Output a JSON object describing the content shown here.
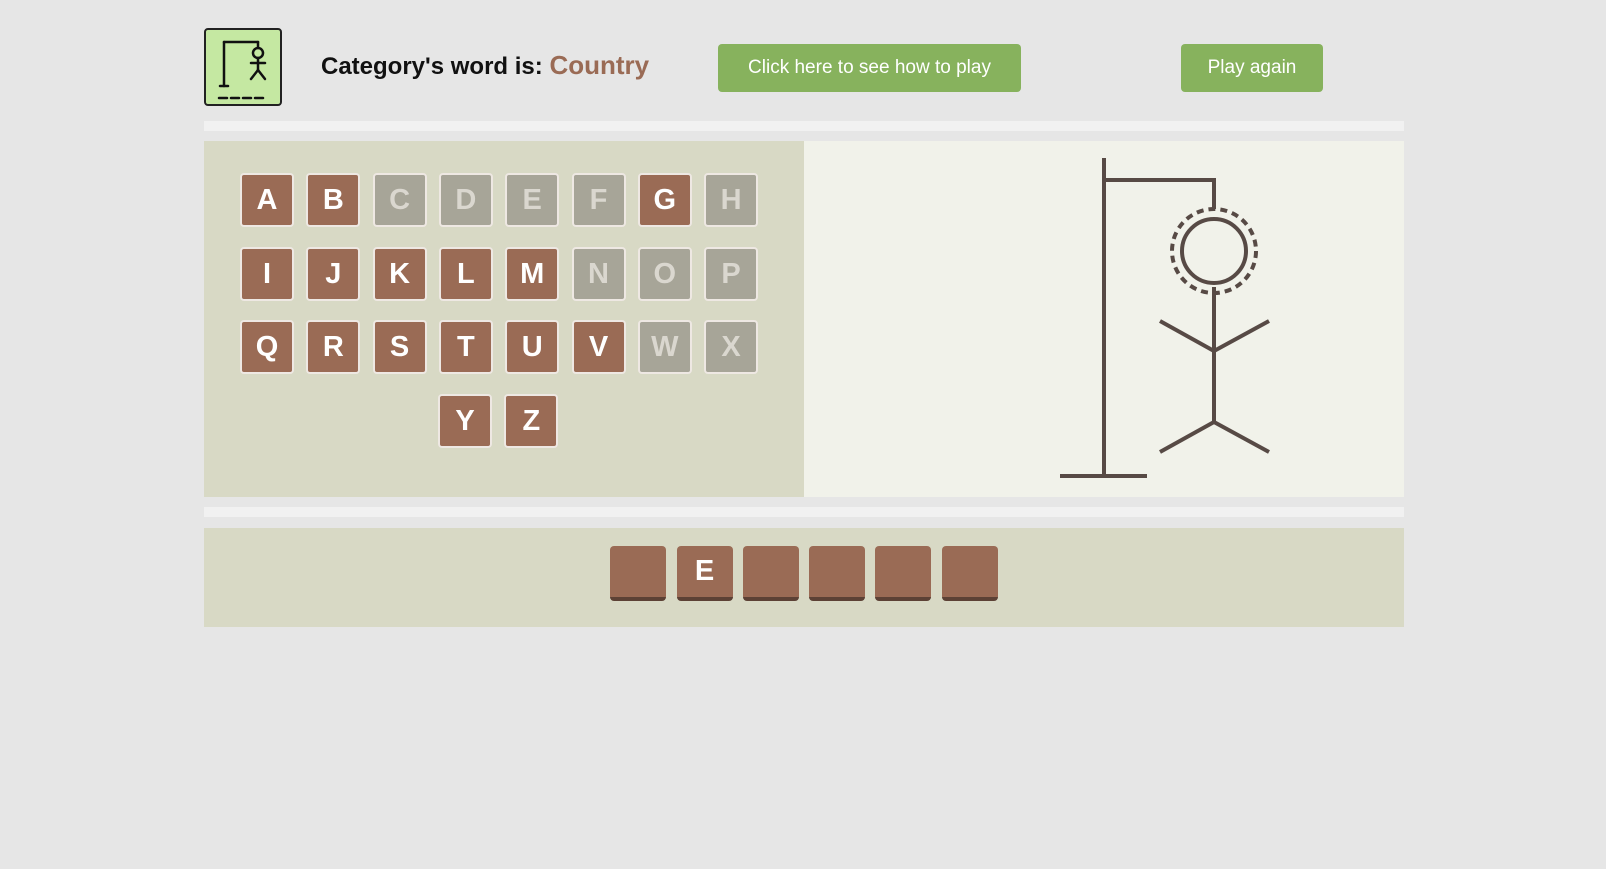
{
  "header": {
    "category_label": "Category's word is:",
    "category_value": "Country",
    "help_button": "Click here to see how to play",
    "play_again_button": "Play again"
  },
  "keyboard": {
    "rows": [
      [
        {
          "letter": "A",
          "state": "active"
        },
        {
          "letter": "B",
          "state": "active"
        },
        {
          "letter": "C",
          "state": "used"
        },
        {
          "letter": "D",
          "state": "used"
        },
        {
          "letter": "E",
          "state": "used"
        },
        {
          "letter": "F",
          "state": "used"
        },
        {
          "letter": "G",
          "state": "active"
        },
        {
          "letter": "H",
          "state": "used"
        }
      ],
      [
        {
          "letter": "I",
          "state": "active"
        },
        {
          "letter": "J",
          "state": "active"
        },
        {
          "letter": "K",
          "state": "active"
        },
        {
          "letter": "L",
          "state": "active"
        },
        {
          "letter": "M",
          "state": "active"
        },
        {
          "letter": "N",
          "state": "used"
        },
        {
          "letter": "O",
          "state": "used"
        },
        {
          "letter": "P",
          "state": "used"
        }
      ],
      [
        {
          "letter": "Q",
          "state": "active"
        },
        {
          "letter": "R",
          "state": "active"
        },
        {
          "letter": "S",
          "state": "active"
        },
        {
          "letter": "T",
          "state": "active"
        },
        {
          "letter": "U",
          "state": "active"
        },
        {
          "letter": "V",
          "state": "active"
        },
        {
          "letter": "W",
          "state": "used"
        },
        {
          "letter": "X",
          "state": "used"
        }
      ],
      [
        {
          "letter": "Y",
          "state": "active"
        },
        {
          "letter": "Z",
          "state": "active"
        }
      ]
    ]
  },
  "answer": {
    "slots": [
      "",
      "E",
      "",
      "",
      "",
      ""
    ]
  },
  "colors": {
    "active_key": "#9a6b55",
    "used_key": "#a7a598",
    "button": "#87b25d",
    "category_value": "#9a6b55",
    "gallows": "#574a45"
  },
  "icons": {
    "logo": "hangman-logo-icon"
  }
}
